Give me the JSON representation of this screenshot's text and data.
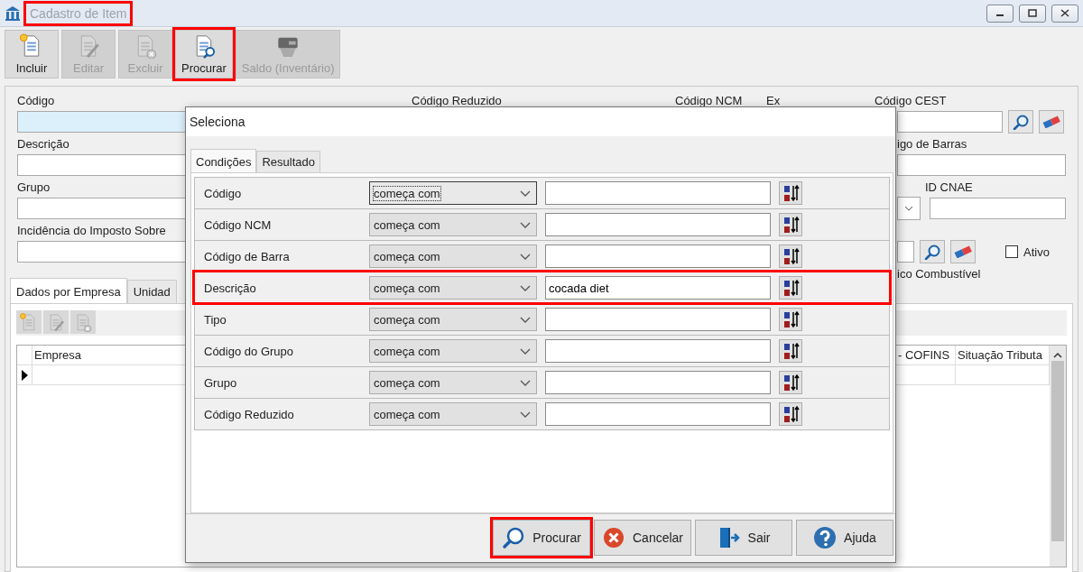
{
  "window": {
    "title": "Cadastro de Item",
    "highlighted": true
  },
  "toolbar": [
    {
      "label": "Incluir",
      "kind": "new",
      "disabled": false,
      "highlighted": false
    },
    {
      "label": "Editar",
      "kind": "edit",
      "disabled": true,
      "highlighted": false
    },
    {
      "label": "Excluir",
      "kind": "delete",
      "disabled": true,
      "highlighted": false
    },
    {
      "label": "Procurar",
      "kind": "search",
      "disabled": false,
      "highlighted": true
    },
    {
      "label": "Saldo (Inventário)",
      "kind": "stock",
      "disabled": true,
      "highlighted": false
    }
  ],
  "form": {
    "header_labels": [
      "Código",
      "Código Reduzido",
      "Código NCM",
      "Ex",
      "Código CEST"
    ],
    "descricao_label": "Descrição",
    "codigo_barras_label": "igo de Barras",
    "grupo_label": "Grupo",
    "id_cnae_label": "ID CNAE",
    "incidencia_label": "Incidência do Imposto Sobre",
    "ativo": {
      "label": "Ativo",
      "checked": false
    },
    "combustivel_label": "ico Combustível"
  },
  "tabs": [
    {
      "label": "Dados por Empresa",
      "selected": true
    },
    {
      "label": "Unidad",
      "selected": false
    }
  ],
  "grid": {
    "columns": [
      "Empresa",
      "- COFINS",
      "Situação Tributa"
    ]
  },
  "dialog": {
    "title": "Seleciona",
    "tabs": [
      {
        "label": "Condições",
        "selected": true
      },
      {
        "label": "Resultado",
        "selected": false
      }
    ],
    "conditions": [
      {
        "field": "Código",
        "operator": "começa com",
        "focused": true,
        "highlighted": false
      },
      {
        "field": "Código NCM",
        "operator": "começa com",
        "focused": false,
        "highlighted": false
      },
      {
        "field": "Código de Barra",
        "operator": "começa com",
        "focused": false,
        "highlighted": false
      },
      {
        "field": "Descrição",
        "operator": "começa com",
        "value": "cocada diet",
        "focused": false,
        "highlighted": true
      },
      {
        "field": "Tipo",
        "operator": "começa com",
        "focused": false,
        "highlighted": false
      },
      {
        "field": "Código do Grupo",
        "operator": "começa com",
        "focused": false,
        "highlighted": false
      },
      {
        "field": "Grupo",
        "operator": "começa com",
        "focused": false,
        "highlighted": false
      },
      {
        "field": "Código Reduzido",
        "operator": "começa com",
        "focused": false,
        "highlighted": false
      }
    ],
    "buttons": [
      {
        "label": "Procurar",
        "kind": "search",
        "highlighted": true
      },
      {
        "label": "Cancelar",
        "kind": "cancel",
        "highlighted": false
      },
      {
        "label": "Sair",
        "kind": "exit",
        "highlighted": false
      },
      {
        "label": "Ajuda",
        "kind": "help",
        "highlighted": false
      }
    ]
  }
}
